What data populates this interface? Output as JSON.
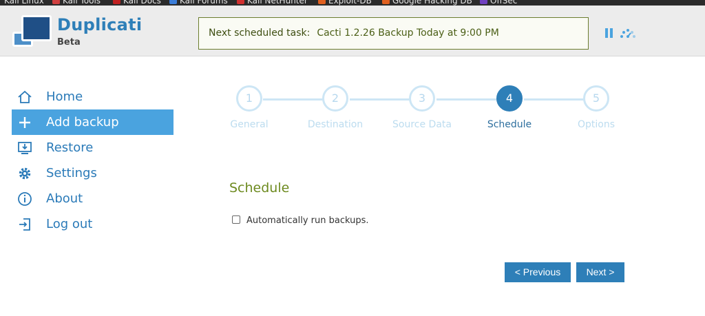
{
  "bookmarks": [
    {
      "label": "Kali Linux",
      "icon": "kali-icon",
      "color": "#3b7dd8"
    },
    {
      "label": "Kali Tools",
      "icon": "kali-tools-icon",
      "color": "#d04040"
    },
    {
      "label": "Kali Docs",
      "icon": "kali-docs-icon",
      "color": "#c02020"
    },
    {
      "label": "Kali Forums",
      "icon": "kali-forums-icon",
      "color": "#3b7dd8"
    },
    {
      "label": "Kali NetHunter",
      "icon": "nethunter-icon",
      "color": "#d03030"
    },
    {
      "label": "Exploit-DB",
      "icon": "exploit-db-icon",
      "color": "#e06020"
    },
    {
      "label": "Google Hacking DB",
      "icon": "ghdb-icon",
      "color": "#e06020"
    },
    {
      "label": "OffSec",
      "icon": "offsec-icon",
      "color": "#7040c0"
    }
  ],
  "header": {
    "brand": "Duplicati",
    "edition": "Beta",
    "next_task_label": "Next scheduled task:",
    "next_task_value": "Cacti 1.2.26 Backup Today at 9:00 PM",
    "pause_icon": "pause-icon",
    "throttle_icon": "speed-gauge-icon"
  },
  "sidebar": {
    "items": [
      {
        "label": "Home",
        "icon": "home-icon",
        "active": false
      },
      {
        "label": "Add backup",
        "icon": "plus-icon",
        "active": true
      },
      {
        "label": "Restore",
        "icon": "restore-icon",
        "active": false
      },
      {
        "label": "Settings",
        "icon": "gear-icon",
        "active": false
      },
      {
        "label": "About",
        "icon": "info-icon",
        "active": false
      },
      {
        "label": "Log out",
        "icon": "logout-icon",
        "active": false
      }
    ]
  },
  "stepper": {
    "steps": [
      {
        "number": "1",
        "label": "General"
      },
      {
        "number": "2",
        "label": "Destination"
      },
      {
        "number": "3",
        "label": "Source Data"
      },
      {
        "number": "4",
        "label": "Schedule"
      },
      {
        "number": "5",
        "label": "Options"
      }
    ],
    "active_step": 4
  },
  "main": {
    "section_title": "Schedule",
    "auto_run_label": "Automatically run backups.",
    "auto_run_checked": false,
    "previous_label": "< Previous",
    "next_label": "Next >"
  },
  "colors": {
    "accent": "#2e7fb8",
    "active_nav": "#4aa3df",
    "title_green": "#6d8a1f",
    "task_border": "#6b7d2e"
  }
}
